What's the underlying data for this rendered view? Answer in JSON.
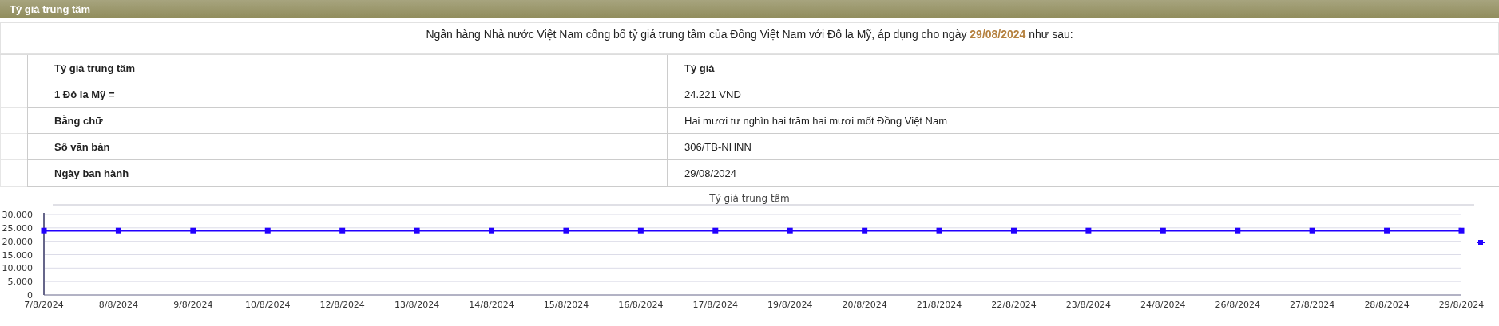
{
  "header": {
    "title": "Tỷ giá trung tâm"
  },
  "intro": "Ngân hàng Nhà nước Việt Nam công bố tỷ giá trung tâm của Đồng Việt Nam với Đô la Mỹ, áp dụng cho ngày **29/08/2024** như sau:",
  "table": {
    "columns": [
      "Tỷ giá trung tâm",
      "Tỷ giá"
    ],
    "rows": [
      [
        "1 Đô la Mỹ =",
        "24.221 VND"
      ],
      [
        "Bằng chữ",
        "Hai mươi tư nghìn hai trăm hai mươi mốt Đồng Việt Nam"
      ],
      [
        "Số văn bản",
        "306/TB-NHNN"
      ],
      [
        "Ngày ban hành",
        "29/08/2024"
      ]
    ]
  },
  "chart": {
    "chart_data": {
      "type": "line",
      "title": "Tỷ giá trung tâm",
      "categories": [
        "7/8/2024",
        "8/8/2024",
        "9/8/2024",
        "10/8/2024",
        "12/8/2024",
        "13/8/2024",
        "14/8/2024",
        "15/8/2024",
        "16/8/2024",
        "17/8/2024",
        "19/8/2024",
        "20/8/2024",
        "21/8/2024",
        "22/8/2024",
        "23/8/2024",
        "24/8/2024",
        "26/8/2024",
        "27/8/2024",
        "28/8/2024",
        "29/8/2024"
      ],
      "series": [
        {
          "color": "#2200ff",
          "marker": "square",
          "values": [
            24000,
            24000,
            24000,
            24000,
            24000,
            24000,
            24000,
            24000,
            24000,
            24000,
            24000,
            24000,
            24000,
            24000,
            24000,
            24000,
            24000,
            24000,
            24000,
            24000
          ]
        }
      ],
      "grid": true,
      "ylim": [
        0,
        30000
      ],
      "yticks": [
        {
          "value": 0,
          "label": "0"
        },
        {
          "value": 5000,
          "label": "5.000"
        },
        {
          "value": 10000,
          "label": "10.000"
        },
        {
          "value": 15000,
          "label": "15.000"
        },
        {
          "value": 20000,
          "label": "20.000"
        },
        {
          "value": 25000,
          "label": "25.000"
        },
        {
          "value": 30000,
          "label": "30.000"
        }
      ]
    }
  }
}
